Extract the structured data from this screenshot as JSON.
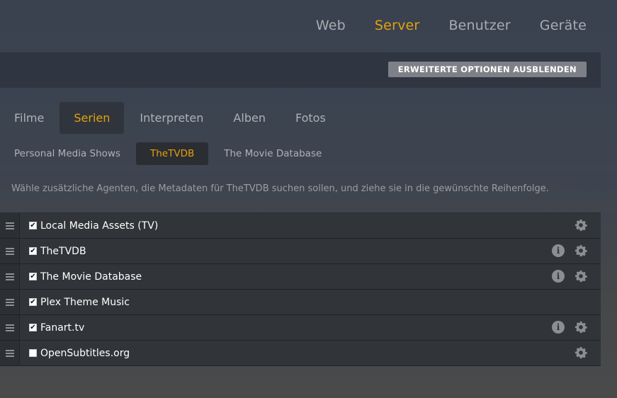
{
  "nav": {
    "items": [
      {
        "label": "Web",
        "active": false
      },
      {
        "label": "Server",
        "active": true
      },
      {
        "label": "Benutzer",
        "active": false
      },
      {
        "label": "Geräte",
        "active": false
      }
    ]
  },
  "toolbar": {
    "advanced_button": "ERWEITERTE OPTIONEN AUSBLENDEN"
  },
  "tabs": [
    {
      "label": "Filme",
      "active": false
    },
    {
      "label": "Serien",
      "active": true
    },
    {
      "label": "Interpreten",
      "active": false
    },
    {
      "label": "Alben",
      "active": false
    },
    {
      "label": "Fotos",
      "active": false
    }
  ],
  "subtabs": [
    {
      "label": "Personal Media Shows",
      "active": false
    },
    {
      "label": "TheTVDB",
      "active": true
    },
    {
      "label": "The Movie Database",
      "active": false
    }
  ],
  "description": "Wähle zusätzliche Agenten, die Metadaten für TheTVDB suchen sollen, und ziehe sie in die gewünschte Reihenfolge.",
  "agents": [
    {
      "name": "Local Media Assets (TV)",
      "checked": true,
      "info": false,
      "settings": true
    },
    {
      "name": "TheTVDB",
      "checked": true,
      "info": true,
      "settings": true
    },
    {
      "name": "The Movie Database",
      "checked": true,
      "info": true,
      "settings": true
    },
    {
      "name": "Plex Theme Music",
      "checked": true,
      "info": false,
      "settings": false
    },
    {
      "name": "Fanart.tv",
      "checked": true,
      "info": true,
      "settings": true
    },
    {
      "name": "OpenSubtitles.org",
      "checked": false,
      "info": false,
      "settings": true
    }
  ],
  "icons": {
    "check": "✔",
    "info": "i",
    "gear": "gear-icon",
    "drag": "drag-handle-icon"
  },
  "colors": {
    "accent": "#e5a00d",
    "button_bg": "#7d8086"
  }
}
